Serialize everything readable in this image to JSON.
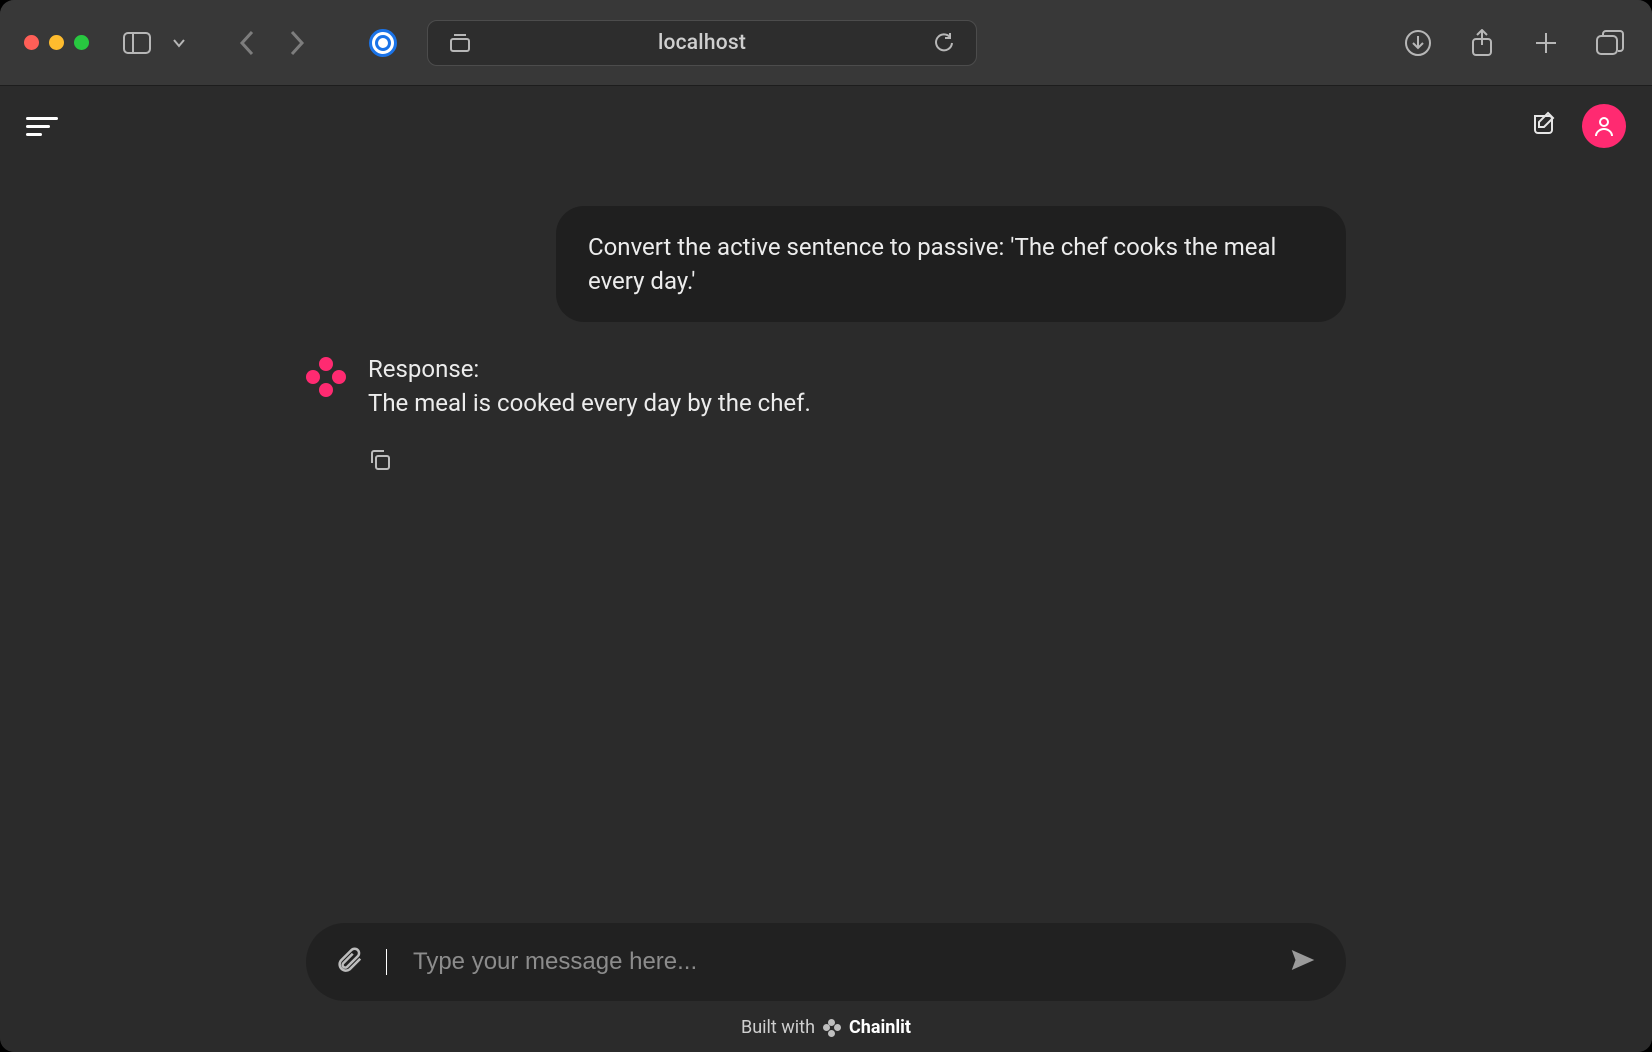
{
  "browser": {
    "url_display": "localhost"
  },
  "chat": {
    "user_message": "Convert the active sentence to passive: 'The chef cooks the meal every day.'",
    "assistant_line1": "Response:",
    "assistant_line2": "The meal is cooked every day by the chef."
  },
  "composer": {
    "placeholder": "Type your message here..."
  },
  "footer": {
    "prefix": "Built with",
    "brand": "Chainlit"
  }
}
